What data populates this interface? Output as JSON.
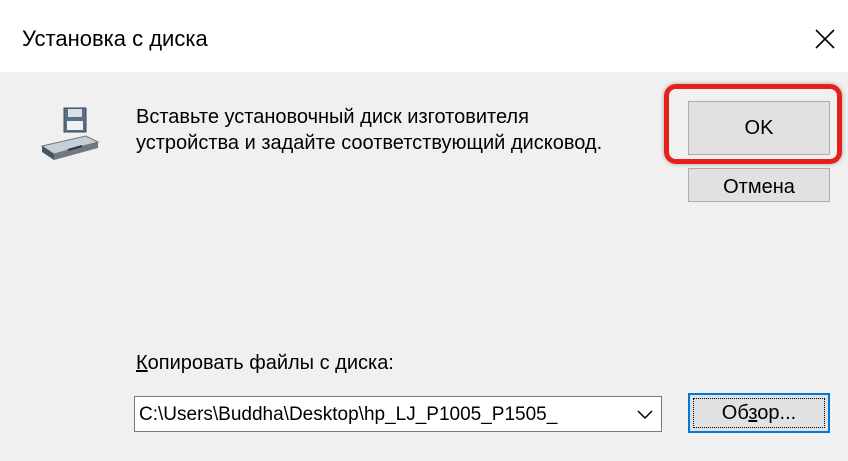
{
  "window": {
    "title": "Установка с диска",
    "close_symbol": "✕"
  },
  "icons": {
    "disk": "floppy-drive-icon",
    "close": "close-icon",
    "dropdown": "chevron-down-icon"
  },
  "message": {
    "line1": "Вставьте установочный диск изготовителя",
    "line2": "устройства и задайте соответствующий дисковод."
  },
  "buttons": {
    "ok_label": "OK",
    "cancel_label": "Отмена",
    "browse_label_pre": "Об",
    "browse_label_underlined": "з",
    "browse_label_post": "ор..."
  },
  "copy_from": {
    "label_underlined": "К",
    "label_rest": "опировать файлы с диска:",
    "value": "C:\\Users\\Buddha\\Desktop\\hp_LJ_P1005_P1505_"
  },
  "colors": {
    "highlight": "#e8201c",
    "focus": "#0078d7"
  }
}
